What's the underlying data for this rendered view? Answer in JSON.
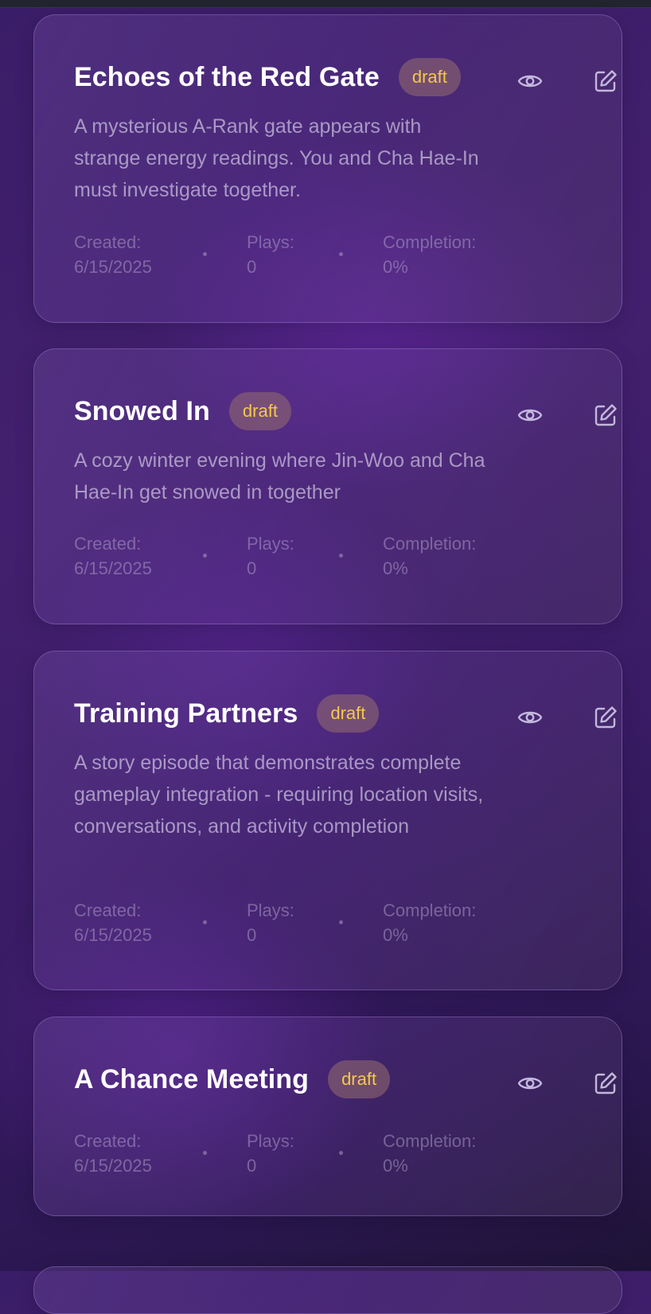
{
  "meta_labels": {
    "created": "Created:",
    "plays": "Plays:",
    "completion": "Completion:"
  },
  "colors": {
    "badge_text": "#f5c84b",
    "title_text": "#ffffff",
    "background": "#3a1d68"
  },
  "icons": {
    "preview": "eye-icon",
    "edit": "edit-icon"
  },
  "episodes": [
    {
      "title": "Echoes of the Red Gate",
      "status": "draft",
      "description": "A mysterious A-Rank gate appears with strange energy readings. You and Cha Hae-In must investigate together.",
      "created": "6/15/2025",
      "plays": "0",
      "completion": "0%"
    },
    {
      "title": "Snowed In",
      "status": "draft",
      "description": "A cozy winter evening where Jin-Woo and Cha Hae-In get snowed in together",
      "created": "6/15/2025",
      "plays": "0",
      "completion": "0%"
    },
    {
      "title": "Training Partners",
      "status": "draft",
      "description": "A story episode that demonstrates complete gameplay integration - requiring location visits, conversations, and activity completion",
      "created": "6/15/2025",
      "plays": "0",
      "completion": "0%"
    },
    {
      "title": "A Chance Meeting",
      "status": "draft",
      "description": "",
      "created": "6/15/2025",
      "plays": "0",
      "completion": "0%"
    }
  ]
}
